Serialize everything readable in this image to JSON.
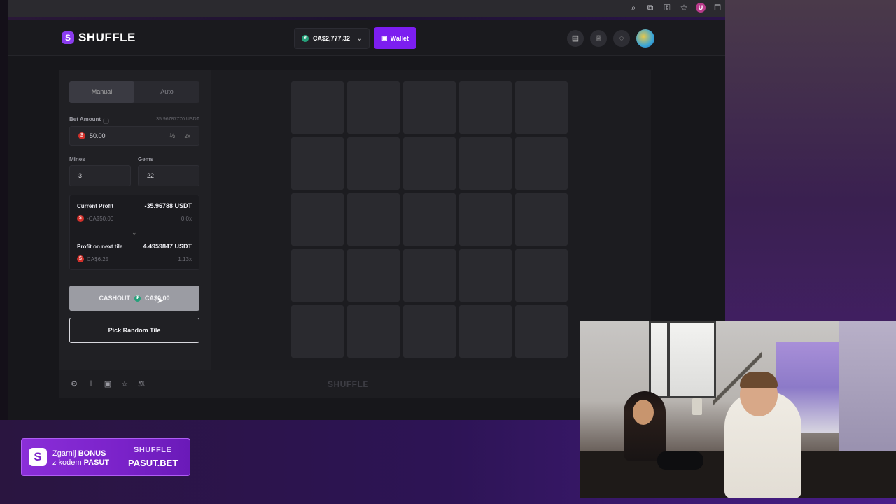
{
  "site": {
    "logo_text": "SHUFFLE",
    "balance": "CA$2,777.32",
    "wallet_label": "Wallet"
  },
  "sidebar": {
    "tabs": [
      "Manual",
      "Auto"
    ],
    "bet_amount_label": "Bet Amount",
    "bet_amount_usdt": "35.96787770 USDT",
    "bet_amount_value": "50.00",
    "half_label": "½",
    "double_label": "2x",
    "mines_label": "Mines",
    "mines_value": "3",
    "gems_label": "Gems",
    "gems_value": "22",
    "current_profit_label": "Current Profit",
    "current_profit_usdt": "-35.96788 USDT",
    "current_profit_cad": "-CA$50.00",
    "current_profit_mult": "0.0x",
    "next_tile_label": "Profit on next tile",
    "next_tile_usdt": "4.4959847 USDT",
    "next_tile_cad": "CA$6.25",
    "next_tile_mult": "1.13x",
    "cashout_label": "CASHOUT",
    "cashout_amount": "CA$0.00",
    "pick_random_label": "Pick Random Tile"
  },
  "grid": {
    "rows": 5,
    "cols": 5
  },
  "footer": {
    "logo_text": "SHUFFLE"
  },
  "promo": {
    "line1_prefix": "Zgarnij ",
    "line1_bold": "BONUS",
    "line2_prefix": "z kodem ",
    "line2_bold": "PASUT",
    "brand": "SHUFFLE",
    "code": "PASUT.BET"
  },
  "colors": {
    "accent": "#7c1ef0",
    "tile": "#2a2a2f",
    "usdt": "#26a17b",
    "coin": "#d4302a"
  }
}
